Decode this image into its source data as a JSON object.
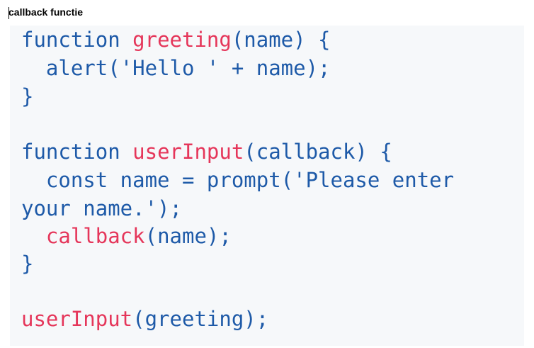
{
  "heading": "callback functie",
  "colors": {
    "keyword": "#1e5aa8",
    "function_name": "#e5365a",
    "background": "#f6f8fa"
  },
  "code": {
    "line1": {
      "kw": "function",
      "sp": " ",
      "fn": "greeting",
      "rest": "(name) {"
    },
    "line2": {
      "indent": "  ",
      "fn": "alert",
      "rest": "('Hello ' + name);"
    },
    "line3": {
      "rest": "}"
    },
    "line5": {
      "kw": "function",
      "sp": " ",
      "fn": "userInput",
      "rest": "(callback) {"
    },
    "line6": {
      "indent": "  ",
      "rest": "const name = prompt('Please enter"
    },
    "line7": {
      "rest": "your name.');"
    },
    "line8": {
      "indent": "  ",
      "fn": "callback",
      "rest": "(name);"
    },
    "line9": {
      "rest": "}"
    },
    "line11": {
      "fn": "userInput",
      "rest": "(greeting);"
    }
  }
}
